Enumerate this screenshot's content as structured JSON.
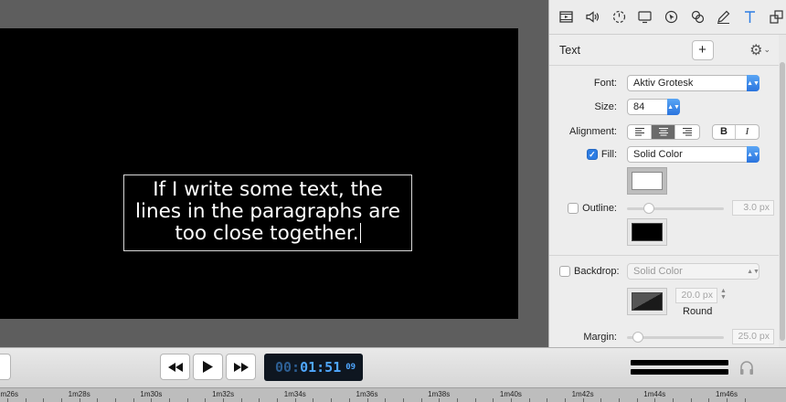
{
  "canvas": {
    "text_lines": [
      "If I write some text, the",
      "lines in the paragraphs are",
      "too close together."
    ]
  },
  "inspector": {
    "tabs": [
      "video-tab-icon",
      "audio-tab-icon",
      "timing-tab-icon",
      "screen-tab-icon",
      "cursor-tab-icon",
      "annotations-tab-icon",
      "draw-tab-icon",
      "text-tab-icon",
      "layout-tab-icon"
    ],
    "active_tab": "text-tab-icon",
    "panel_title": "Text",
    "add_label": "+",
    "font": {
      "label": "Font:",
      "value": "Aktiv Grotesk"
    },
    "size": {
      "label": "Size:",
      "value": "84"
    },
    "alignment": {
      "label": "Alignment:",
      "selected": "center",
      "bold": "B",
      "italic": "I"
    },
    "fill": {
      "label": "Fill:",
      "checked": true,
      "value": "Solid Color",
      "color": "#ffffff"
    },
    "outline": {
      "label": "Outline:",
      "checked": false,
      "value": "3.0 px",
      "color": "#000000",
      "level": 0.08
    },
    "backdrop": {
      "label": "Backdrop:",
      "checked": false,
      "value": "Solid Color",
      "radius_value": "20.0 px",
      "radius_label": "Round"
    },
    "margin": {
      "label": "Margin:",
      "value": "25.0 px",
      "level": 0.08
    }
  },
  "transport": {
    "timecode_dim": "00:",
    "timecode_main": "01:51",
    "timecode_frames": "09",
    "buttons": [
      "rewind-icon",
      "play-icon",
      "fast-forward-icon"
    ]
  },
  "ruler": {
    "labels": [
      "1m26s",
      "1m28s",
      "1m30s",
      "1m32s",
      "1m34s",
      "1m36s",
      "1m38s",
      "1m40s",
      "1m42s",
      "1m44s",
      "1m46s"
    ]
  },
  "colors": {
    "accent": "#2d7de3",
    "timecode": "#4fa7ff"
  }
}
